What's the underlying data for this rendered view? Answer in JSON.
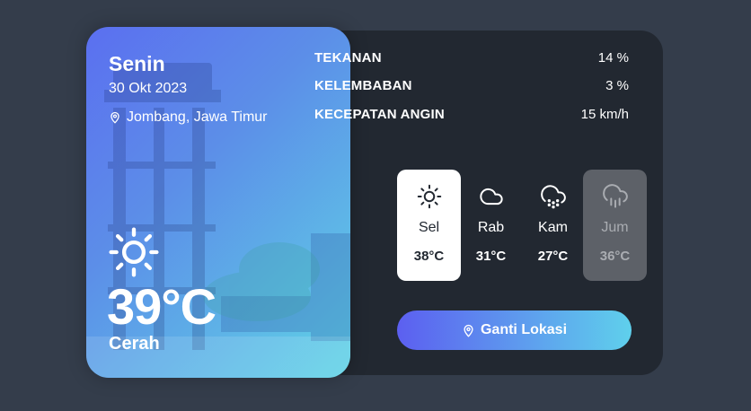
{
  "weather": {
    "day": "Senin",
    "date": "30 Okt 2023",
    "location": "Jombang, Jawa Timur",
    "temperature": "39°C",
    "condition": "Cerah",
    "icon": "sun-icon"
  },
  "stats": [
    {
      "label": "TEKANAN",
      "value": "14 %"
    },
    {
      "label": "KELEMBABAN",
      "value": "3 %"
    },
    {
      "label": "KECEPATAN ANGIN",
      "value": "15 km/h"
    }
  ],
  "forecast": [
    {
      "day": "Sel",
      "temp": "38°C",
      "icon": "sun-icon",
      "state": "active"
    },
    {
      "day": "Rab",
      "temp": "31°C",
      "icon": "cloud-icon",
      "state": "normal"
    },
    {
      "day": "Kam",
      "temp": "27°C",
      "icon": "cloud-snow-icon",
      "state": "normal"
    },
    {
      "day": "Jum",
      "temp": "36°C",
      "icon": "cloud-rain-icon",
      "state": "dim"
    }
  ],
  "button": {
    "label": "Ganti Lokasi",
    "icon": "map-pin-icon"
  },
  "colors": {
    "page_bg": "#343d4b",
    "panel_bg": "#222831",
    "gradient_start": "#5c5ff0",
    "gradient_end": "#5fd0ec"
  }
}
